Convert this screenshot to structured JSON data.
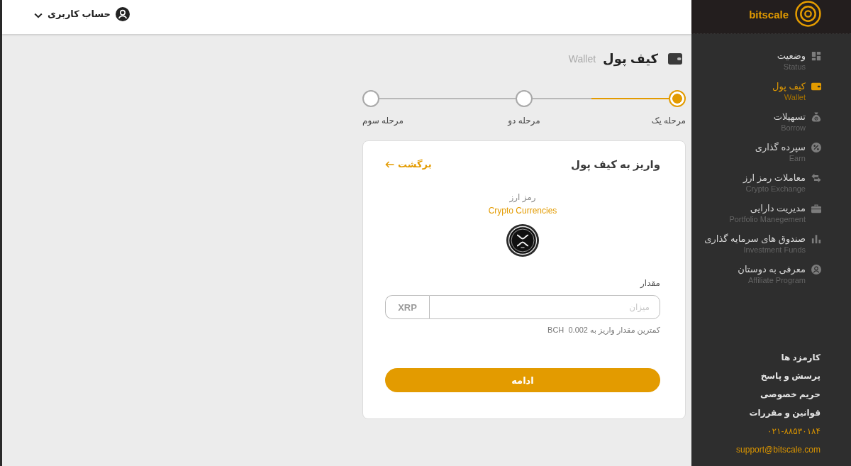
{
  "topbar": {
    "account_label": "حساب کاربری"
  },
  "sidebar": {
    "logo": "bitscale",
    "items": [
      {
        "title": "وضعیت",
        "subtitle": "Status",
        "selected": false
      },
      {
        "title": "کیف پول",
        "subtitle": "Wallet",
        "selected": true
      },
      {
        "title": "تسهیلات",
        "subtitle": "Borrow",
        "selected": false
      },
      {
        "title": "سپرده گذاری",
        "subtitle": "Earn",
        "selected": false
      },
      {
        "title": "معاملات رمز ارز",
        "subtitle": "Crypto Exchange",
        "selected": false
      },
      {
        "title": "مدیریت دارایی",
        "subtitle": "Portfolio Manegement",
        "selected": false
      },
      {
        "title": "صندوق های سرمایه گذاری",
        "subtitle": "Investment Funds",
        "selected": false
      },
      {
        "title": "معرفی به دوستان",
        "subtitle": "Affiliate Program",
        "selected": false
      }
    ],
    "footer_links": [
      "کارمزد ها",
      "پرسش و پاسخ",
      "حریم خصوصی",
      "قوانین و مقررات"
    ],
    "phone": "۰۲۱-۸۸۵۳۰۱۸۴",
    "email": "support@bitscale.com"
  },
  "page_header": {
    "title": "کیف پول",
    "subtitle": "Wallet"
  },
  "stepper": {
    "steps": [
      {
        "label": "مرحله یک",
        "selected": true
      },
      {
        "label": "مرحله دو",
        "selected": false
      },
      {
        "label": "مرحله سوم",
        "selected": false
      }
    ],
    "progress": {
      "level": 0.57
    }
  },
  "deposit_card": {
    "title": "واریز به کیف پول",
    "back_link": "برگشت",
    "currency_label": "رمز ارز",
    "currency_name": "Crypto Currencies",
    "amount_label": "مقدار",
    "amount_input": {
      "placeholder": "میزان"
    },
    "unit": "XRP",
    "hint": "کمترین مقدار واریز به 0.002  BCH",
    "submit": "ادامه"
  }
}
